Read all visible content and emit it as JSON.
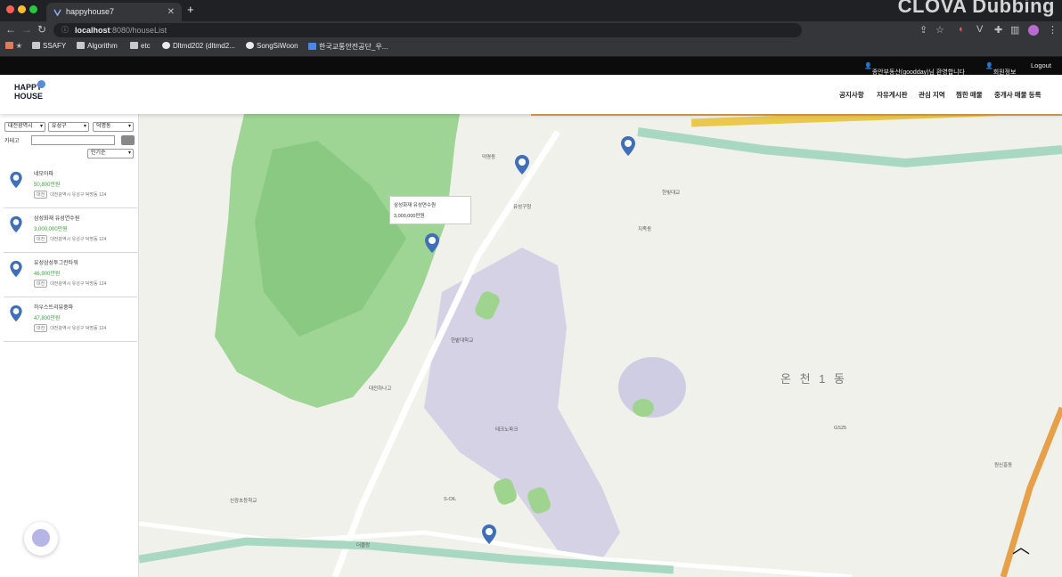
{
  "browser": {
    "tab_title": "happyhouse7",
    "url_host": "localhost",
    "url_path": ":8080/houseList",
    "watermark": "CLOVA Dubbing",
    "bookmarks": [
      "SSAFY",
      "Algorithm",
      "etc",
      "Dltmd202 (dltmd2...",
      "SongSiWoon",
      "한국교통안전공단_우..."
    ]
  },
  "topbar": {
    "user": "종안부동산(goodday)님 환영합니다",
    "mypage": "회원정보",
    "logout": "Logout"
  },
  "header": {
    "logo_line1": "HAPPY",
    "logo_line2": "HOUSE",
    "menu": [
      "공지사항",
      "자유게시판",
      "관심 지역",
      "찜한 매물",
      "중개사 매물 등록"
    ]
  },
  "sidebar": {
    "sido": "대전광역시",
    "gugun": "유성구",
    "dong": "덕명동",
    "apt_label": "카테고",
    "sort": "인기순",
    "items": [
      {
        "name": "네모아파",
        "price": "50,800만원",
        "tag": "대전",
        "addr": "대전광역시 유성구 덕명동 124"
      },
      {
        "name": "삼성화재 유성연수원",
        "price": "3,000,000만원",
        "tag": "대전",
        "addr": "대전광역시 유성구 덕명동 124"
      },
      {
        "name": "유성삼성투그린타워",
        "price": "46,900만원",
        "tag": "대전",
        "addr": "대전광역시 유성구 덕명동 124"
      },
      {
        "name": "하우스트리뷰중파",
        "price": "47,800만원",
        "tag": "대전",
        "addr": "대전광역시 유성구 덕명동 124"
      }
    ]
  },
  "map": {
    "infowindow_title": "삼성화재 유성연수원",
    "infowindow_price": "3,000,000만원",
    "district": "온 천 1 동",
    "labels": [
      "덕명동",
      "한빛대교",
      "대전하나고",
      "S-OIL",
      "더블랑",
      "신광초등학교",
      "유성구청",
      "한밭대학교",
      "지족동",
      "테크노파크",
      "GS25",
      "원신흥동"
    ]
  },
  "colors": {
    "accent": "#3da33d",
    "pin": "#3f6fb8",
    "golf": "#7fc27a",
    "road": "#e7a04a"
  }
}
